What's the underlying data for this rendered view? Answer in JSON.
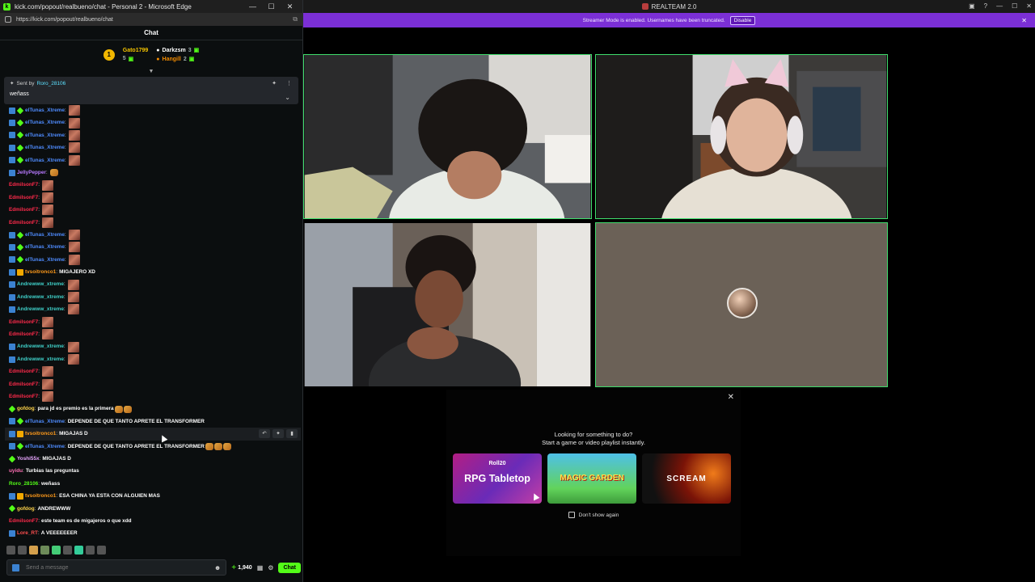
{
  "popout": {
    "window_title": "kick.com/popout/realbueno/chat - Personal 2 - Microsoft Edge",
    "url": "https://kick.com/popout/realbueno/chat",
    "chat_header": "Chat",
    "gifters": [
      {
        "name": "Gato1799",
        "count": "5"
      },
      {
        "name": "Darkzsm",
        "count": "3"
      },
      {
        "name": "Hangill",
        "count": "2"
      }
    ],
    "pinned": {
      "sent_by_label": "Sent by",
      "sender": "Roro_28106",
      "message": "weñass"
    },
    "messages": [
      {
        "user": "elTunas_Xtreme",
        "color": "#4f8cff",
        "badges": [
          "blue",
          "green"
        ],
        "text": "",
        "emotes": 1
      },
      {
        "user": "elTunas_Xtreme",
        "color": "#4f8cff",
        "badges": [
          "blue",
          "green"
        ],
        "text": "",
        "emotes": 1
      },
      {
        "user": "elTunas_Xtreme",
        "color": "#4f8cff",
        "badges": [
          "blue",
          "green"
        ],
        "text": "",
        "emotes": 1
      },
      {
        "user": "elTunas_Xtreme",
        "color": "#4f8cff",
        "badges": [
          "blue",
          "green"
        ],
        "text": "",
        "emotes": 1
      },
      {
        "user": "elTunas_Xtreme",
        "color": "#4f8cff",
        "badges": [
          "blue",
          "green"
        ],
        "text": "",
        "emotes": 1
      },
      {
        "user": "JellyPepper",
        "color": "#b779ff",
        "badges": [
          "blue"
        ],
        "text": "",
        "emotes": 0,
        "cat": true
      },
      {
        "user": "EdmilsonF7",
        "color": "#ff2a4b",
        "badges": [],
        "text": "",
        "emotes": 1
      },
      {
        "user": "EdmilsonF7",
        "color": "#ff2a4b",
        "badges": [],
        "text": "",
        "emotes": 1
      },
      {
        "user": "EdmilsonF7",
        "color": "#ff2a4b",
        "badges": [],
        "text": "",
        "emotes": 1
      },
      {
        "user": "EdmilsonF7",
        "color": "#ff2a4b",
        "badges": [],
        "text": "",
        "emotes": 1
      },
      {
        "user": "elTunas_Xtreme",
        "color": "#4f8cff",
        "badges": [
          "blue",
          "green"
        ],
        "text": "",
        "emotes": 1
      },
      {
        "user": "elTunas_Xtreme",
        "color": "#4f8cff",
        "badges": [
          "blue",
          "green"
        ],
        "text": "",
        "emotes": 1
      },
      {
        "user": "elTunas_Xtreme",
        "color": "#4f8cff",
        "badges": [
          "blue",
          "green"
        ],
        "text": "",
        "emotes": 1
      },
      {
        "user": "tvsoitronco1",
        "color": "#ff9a1a",
        "badges": [
          "blue",
          "gold"
        ],
        "text": "MIGAJERO XD",
        "emotes": 0
      },
      {
        "user": "Andrewww_xtreme",
        "color": "#3fd0c9",
        "badges": [
          "blue"
        ],
        "text": "",
        "emotes": 1
      },
      {
        "user": "Andrewww_xtreme",
        "color": "#3fd0c9",
        "badges": [
          "blue"
        ],
        "text": "",
        "emotes": 1
      },
      {
        "user": "Andrewww_xtreme",
        "color": "#3fd0c9",
        "badges": [
          "blue"
        ],
        "text": "",
        "emotes": 1
      },
      {
        "user": "EdmilsonF7",
        "color": "#ff2a4b",
        "badges": [],
        "text": "",
        "emotes": 1
      },
      {
        "user": "EdmilsonF7",
        "color": "#ff2a4b",
        "badges": [],
        "text": "",
        "emotes": 1
      },
      {
        "user": "Andrewww_xtreme",
        "color": "#3fd0c9",
        "badges": [
          "blue"
        ],
        "text": "",
        "emotes": 1
      },
      {
        "user": "Andrewww_xtreme",
        "color": "#3fd0c9",
        "badges": [
          "blue"
        ],
        "text": "",
        "emotes": 1
      },
      {
        "user": "EdmilsonF7",
        "color": "#ff2a4b",
        "badges": [],
        "text": "",
        "emotes": 1
      },
      {
        "user": "EdmilsonF7",
        "color": "#ff2a4b",
        "badges": [],
        "text": "",
        "emotes": 1
      },
      {
        "user": "EdmilsonF7",
        "color": "#ff2a4b",
        "badges": [],
        "text": "",
        "emotes": 1
      },
      {
        "user": "gofdog",
        "color": "#ffd44a",
        "badges": [
          "green"
        ],
        "text": "para jd es premio es la primera",
        "emotes": 0,
        "cat": true
      },
      {
        "user": "elTunas_Xtreme",
        "color": "#4f8cff",
        "badges": [
          "blue",
          "green"
        ],
        "text": "DEPENDE DE QUE TANTO APRETE EL TRANSFORMER",
        "emotes": 0
      },
      {
        "user": "tvsoitronco1",
        "color": "#ff9a1a",
        "badges": [
          "blue",
          "gold"
        ],
        "text": "MIGAJAS D",
        "emotes": 0,
        "hover": true
      },
      {
        "user": "elTunas_Xtreme",
        "color": "#4f8cff",
        "badges": [
          "blue",
          "green"
        ],
        "text": "DEPENDE DE QUE TANTO APRETE EL TRANSFORMER",
        "emotes": 0,
        "cat3": true
      },
      {
        "user": "Yoshi55x",
        "color": "#e9a6ff",
        "badges": [
          "green"
        ],
        "text": "MIGAJAS D",
        "emotes": 0
      },
      {
        "user": "uyidu",
        "color": "#ff6fb5",
        "badges": [],
        "text": "Turbias las preguntas",
        "emotes": 0
      },
      {
        "user": "Roro_28106",
        "color": "#53fc18",
        "badges": [],
        "text": "weñass",
        "emotes": 0
      },
      {
        "user": "tvsoitronco1",
        "color": "#ff9a1a",
        "badges": [
          "blue",
          "gold"
        ],
        "text": "ESA CHINA YA ESTA CON ALGUIEN MAS",
        "emotes": 0
      },
      {
        "user": "gofdog",
        "color": "#ffd44a",
        "badges": [
          "green"
        ],
        "text": "ANDREWWW",
        "emotes": 0
      },
      {
        "user": "EdmilsonF7",
        "color": "#ff2a4b",
        "badges": [],
        "text": "este team es de migajeros o que xdd",
        "emotes": 0
      },
      {
        "user": "Lore_RT",
        "color": "#ff4f4f",
        "badges": [
          "blue"
        ],
        "text": "A VEEEEEEER",
        "emotes": 0
      }
    ],
    "input_placeholder": "Send a message",
    "points": "1,940",
    "send_label": "Chat"
  },
  "app": {
    "title": "REALTEAM 2.0",
    "banner_text": "Streamer Mode is enabled. Usernames have been truncated.",
    "banner_button": "Disable",
    "promo": {
      "title_line1": "Looking for something to do?",
      "title_line2": "Start a game or video playlist instantly.",
      "cards": [
        {
          "sub": "Roll20",
          "label": "RPG Tabletop"
        },
        {
          "label": "MAGIC GARDEN"
        },
        {
          "label": "SCREAM"
        }
      ],
      "dont_show": "Don't show again"
    }
  },
  "colors": {
    "accent_green": "#53fc18",
    "banner_purple": "#7b2fd6",
    "tile_border": "#3fdd6c"
  }
}
